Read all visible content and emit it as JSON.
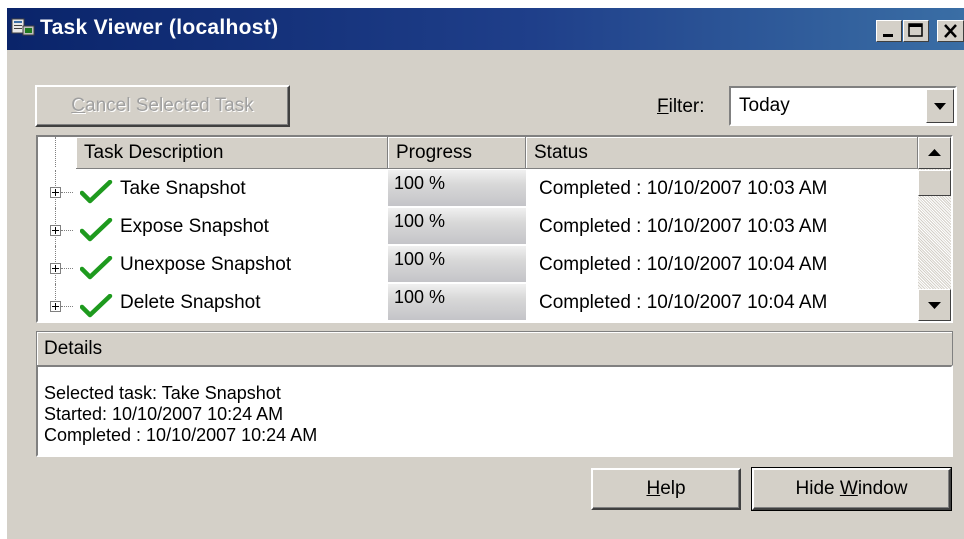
{
  "window": {
    "title": "Task Viewer (localhost)",
    "icon": "task-viewer-app-icon",
    "controls": [
      "minimize-icon",
      "maximize-icon",
      "close-icon"
    ]
  },
  "toolbar": {
    "cancel_label_first": "C",
    "cancel_label_rest": "ancel Selected Task",
    "cancel_enabled": false,
    "filter_label_first": "F",
    "filter_label_rest": "ilter:",
    "filter_value": "Today"
  },
  "table": {
    "headers": [
      "Task Description",
      "Progress",
      "Status"
    ],
    "rows": [
      {
        "name": "Take Snapshot",
        "progress": "100 %",
        "progress_fraction": 1.0,
        "status": "Completed : 10/10/2007 10:03 AM",
        "icon": "check-icon"
      },
      {
        "name": "Expose Snapshot",
        "progress": "100 %",
        "progress_fraction": 1.0,
        "status": "Completed : 10/10/2007 10:03 AM",
        "icon": "check-icon"
      },
      {
        "name": "Unexpose Snapshot",
        "progress": "100 %",
        "progress_fraction": 1.0,
        "status": "Completed : 10/10/2007 10:04 AM",
        "icon": "check-icon"
      },
      {
        "name": "Delete Snapshot",
        "progress": "100 %",
        "progress_fraction": 1.0,
        "status": "Completed : 10/10/2007 10:04 AM",
        "icon": "check-icon"
      }
    ]
  },
  "details": {
    "header": "Details",
    "lines": [
      "Selected task: Take Snapshot",
      "Started: 10/10/2007 10:24 AM",
      "Completed : 10/10/2007 10:24 AM"
    ]
  },
  "buttons": {
    "help_first": "H",
    "help_rest": "elp",
    "hide_prefix": "Hide ",
    "hide_underlined": "W",
    "hide_suffix": "indow"
  },
  "colors": {
    "title_bar": "#0a246a",
    "face": "#d4d0c8",
    "check": "#1e9a1e"
  }
}
